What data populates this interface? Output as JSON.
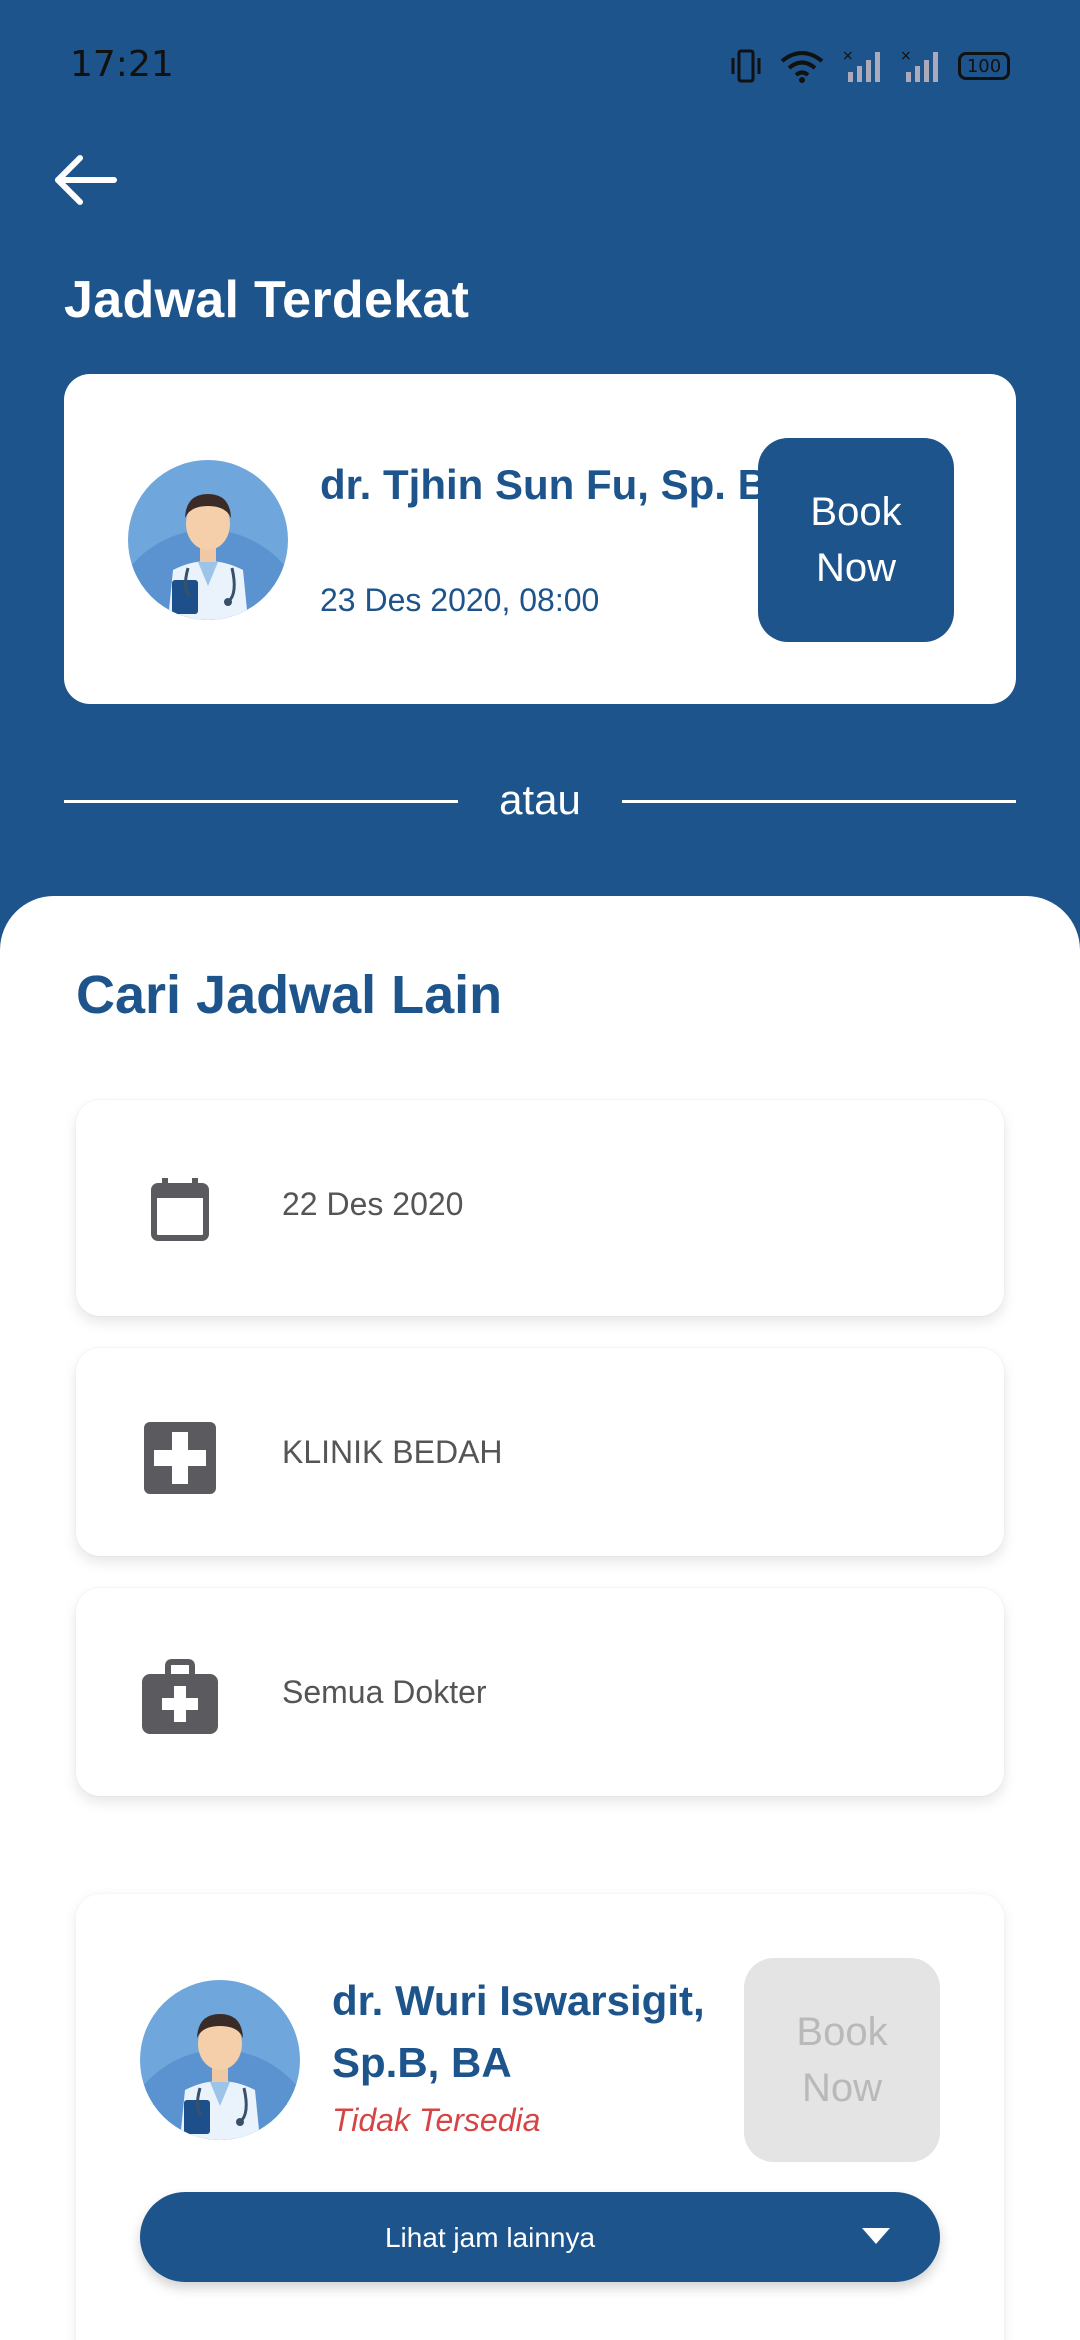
{
  "status_bar": {
    "time": "17:21",
    "battery": "100"
  },
  "header": {
    "title": "Jadwal Terdekat"
  },
  "nearest": {
    "doctor_name": "dr. Tjhin Sun Fu, Sp. B",
    "date": "23 Des 2020, 08:00",
    "book_label": "Book Now"
  },
  "divider_text": "atau",
  "search": {
    "title": "Cari Jadwal Lain",
    "date_value": "22 Des 2020",
    "clinic_value": "KLINIK BEDAH",
    "doctor_value": "Semua Dokter"
  },
  "result": {
    "doctor_name": "dr. Wuri Iswarsigit, Sp.B, BA",
    "status": "Tidak Tersedia",
    "book_label": "Book Now",
    "more_label": "Lihat jam lainnya"
  },
  "colors": {
    "primary": "#1c548b",
    "unavailable": "#d64545",
    "disabled_bg": "#e4e4e4"
  },
  "icons": [
    "back-arrow-icon",
    "calendar-icon",
    "medical-cross-icon",
    "medical-kit-icon",
    "chevron-down-icon"
  ]
}
